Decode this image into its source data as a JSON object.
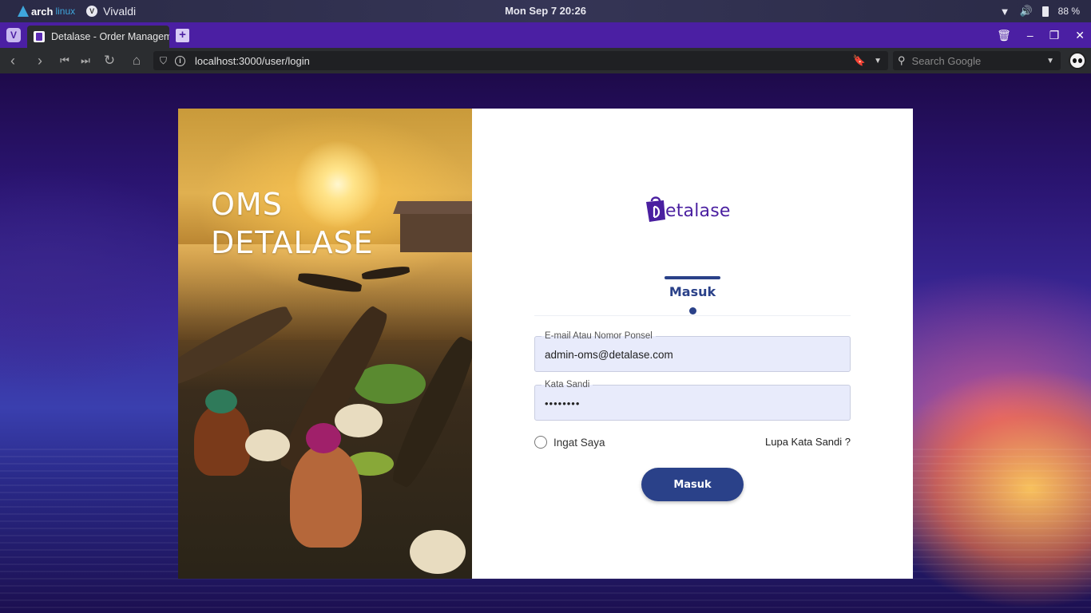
{
  "desktop": {
    "distro_logo": "arch",
    "distro_logo_suffix": "linux",
    "app_name": "Vivaldi",
    "clock": "Mon Sep 7  20:26",
    "battery_percent": "88 %"
  },
  "browser": {
    "tab_title": "Detalase - Order Management",
    "url": "localhost:3000/user/login",
    "search_placeholder": "Search Google"
  },
  "hero": {
    "line1": "OMS",
    "line2": "DETALASE"
  },
  "brand": {
    "logo_text": "etalase",
    "logo_color": "#4a1fa0"
  },
  "login": {
    "tab_label": "Masuk",
    "email_label": "E-mail Atau Nomor Ponsel",
    "email_value": "admin-oms@detalase.com",
    "password_label": "Kata Sandi",
    "password_value": "••••••••",
    "remember_label": "Ingat Saya",
    "forgot_label": "Lupa Kata Sandi ?",
    "submit_label": "Masuk",
    "accent_color": "#2a4189"
  }
}
